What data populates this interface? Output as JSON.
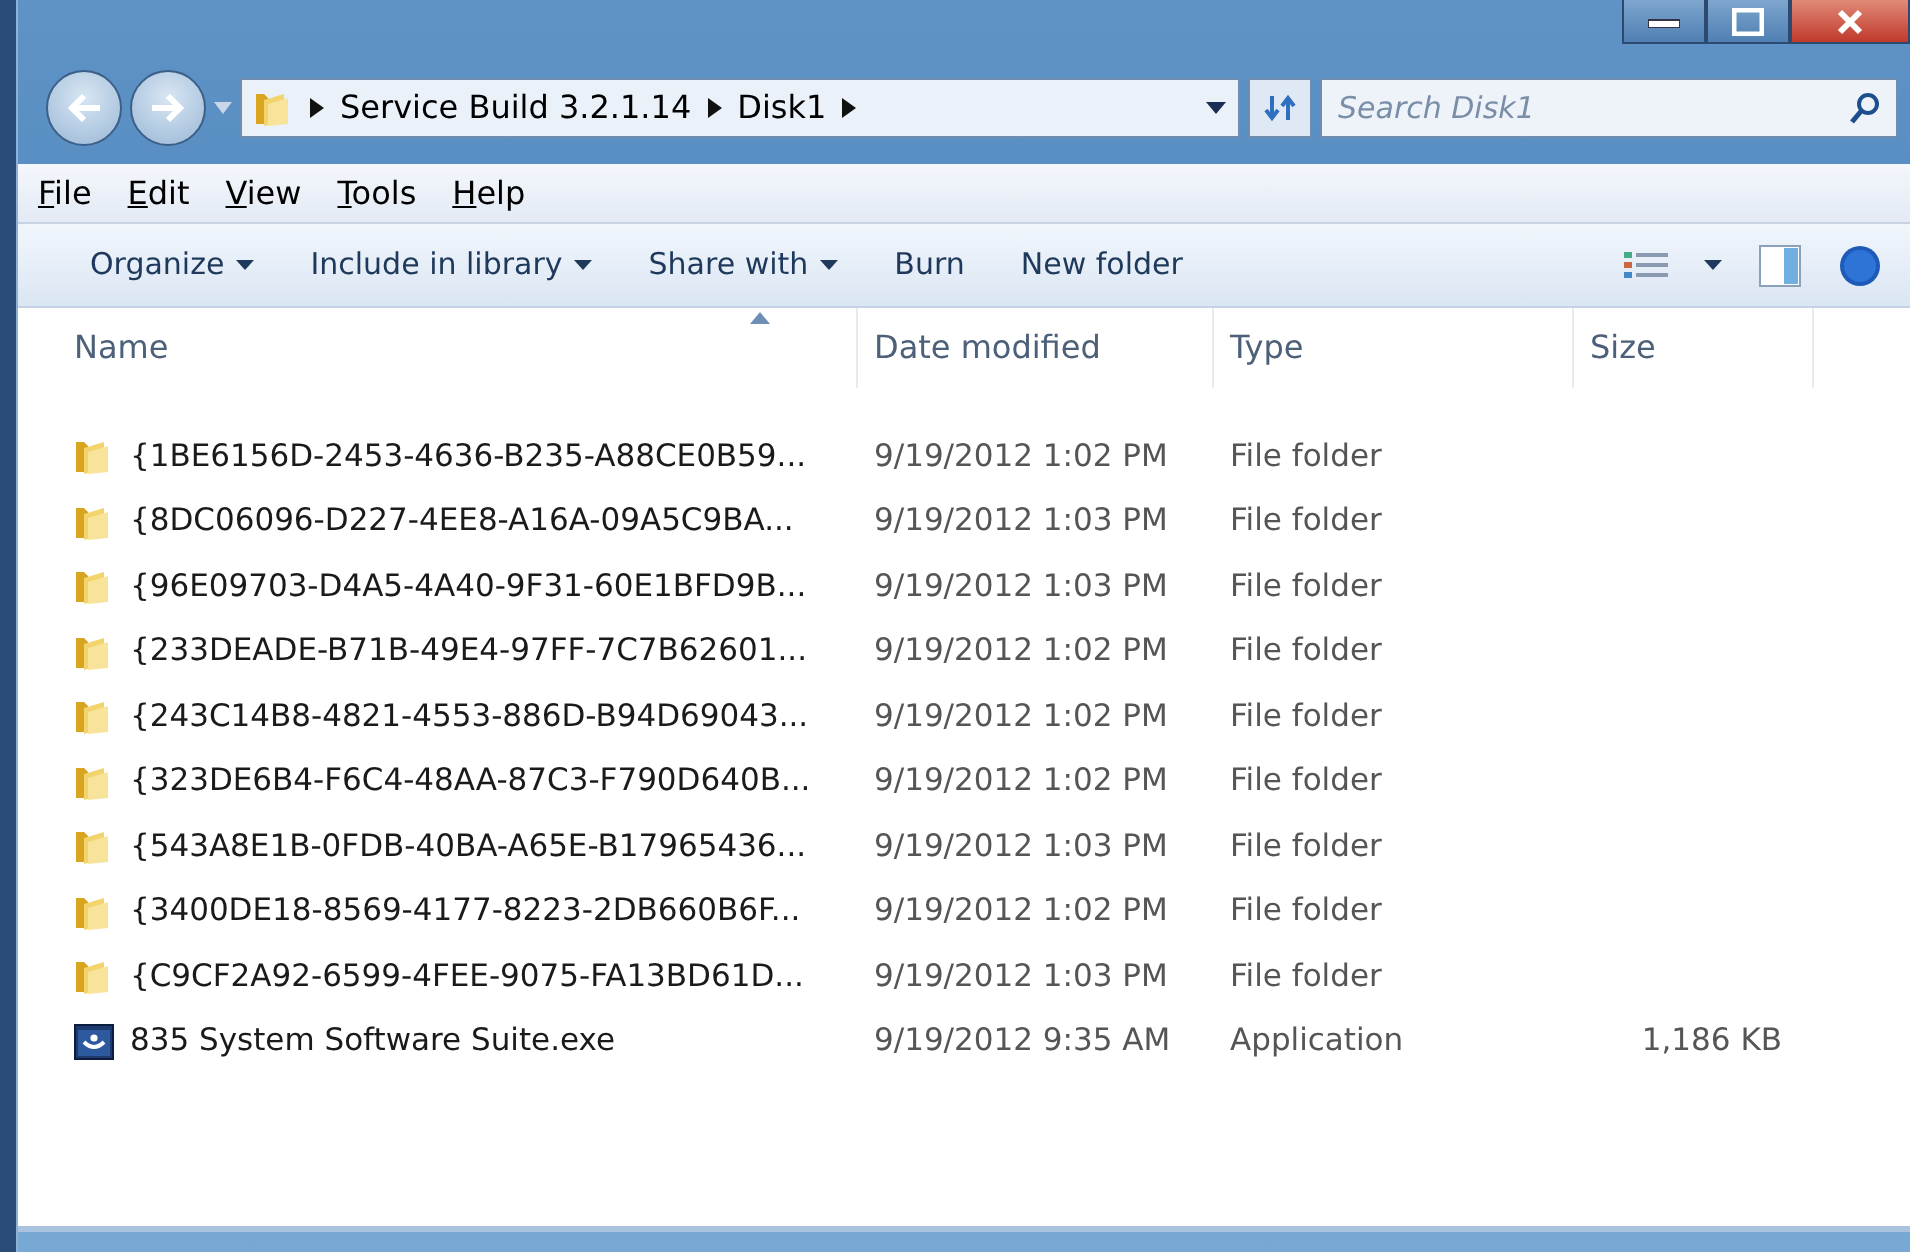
{
  "address_bar": {
    "path": [
      "Service Build 3.2.1.14",
      "Disk1"
    ]
  },
  "search": {
    "placeholder": "Search Disk1"
  },
  "menu": [
    "File",
    "Edit",
    "View",
    "Tools",
    "Help"
  ],
  "toolbar": [
    {
      "label": "Organize",
      "dropdown": true
    },
    {
      "label": "Include in library",
      "dropdown": true
    },
    {
      "label": "Share with",
      "dropdown": true
    },
    {
      "label": "Burn",
      "dropdown": false
    },
    {
      "label": "New folder",
      "dropdown": false
    }
  ],
  "columns": [
    "Name",
    "Date modified",
    "Type",
    "Size"
  ],
  "rows": [
    {
      "kind": "folder",
      "name": "{1BE6156D-2453-4636-B235-A88CE0B59...",
      "date": "9/19/2012 1:02 PM",
      "type": "File folder"
    },
    {
      "kind": "folder",
      "name": "{8DC06096-D227-4EE8-A16A-09A5C9BA...",
      "date": "9/19/2012 1:03 PM",
      "type": "File folder"
    },
    {
      "kind": "folder",
      "name": "{96E09703-D4A5-4A40-9F31-60E1BFD9B...",
      "date": "9/19/2012 1:03 PM",
      "type": "File folder"
    },
    {
      "kind": "folder",
      "name": "{233DEADE-B71B-49E4-97FF-7C7B62601...",
      "date": "9/19/2012 1:02 PM",
      "type": "File folder"
    },
    {
      "kind": "folder",
      "name": "{243C14B8-4821-4553-886D-B94D69043...",
      "date": "9/19/2012 1:02 PM",
      "type": "File folder"
    },
    {
      "kind": "folder",
      "name": "{323DE6B4-F6C4-48AA-87C3-F790D640B...",
      "date": "9/19/2012 1:02 PM",
      "type": "File folder"
    },
    {
      "kind": "folder",
      "name": "{543A8E1B-0FDB-40BA-A65E-B17965436...",
      "date": "9/19/2012 1:03 PM",
      "type": "File folder"
    },
    {
      "kind": "folder",
      "name": "{3400DE18-8569-4177-8223-2DB660B6F...",
      "date": "9/19/2012 1:02 PM",
      "type": "File folder"
    },
    {
      "kind": "folder",
      "name": "{C9CF2A92-6599-4FEE-9075-FA13BD61D...",
      "date": "9/19/2012 1:03 PM",
      "type": "File folder"
    },
    {
      "kind": "application",
      "name": "835 System Software Suite.exe",
      "date": "9/19/2012 9:35 AM",
      "type": "Application",
      "size": "1,186 KB"
    }
  ]
}
